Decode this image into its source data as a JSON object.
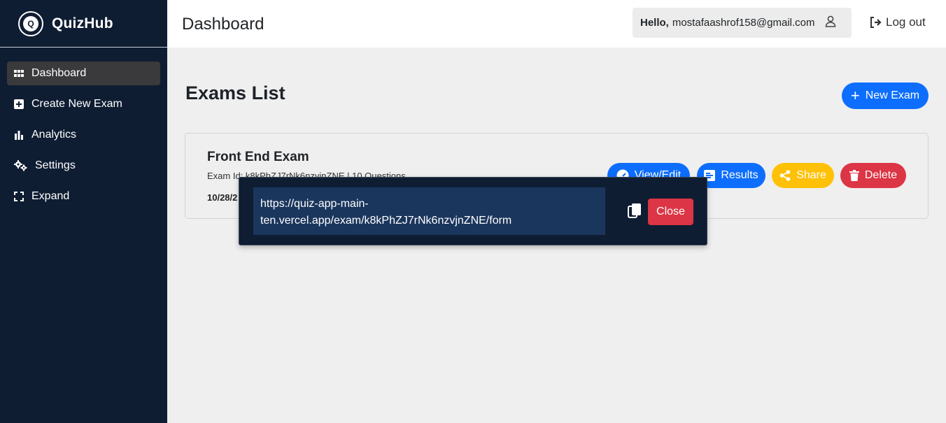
{
  "app": {
    "name": "QuizHub",
    "logo_letter": "Q"
  },
  "sidebar": {
    "items": [
      {
        "label": "Dashboard",
        "icon": "grid-icon",
        "active": true
      },
      {
        "label": "Create New Exam",
        "icon": "plus-square-icon"
      },
      {
        "label": "Analytics",
        "icon": "bar-chart-icon"
      },
      {
        "label": "Settings",
        "icon": "gears-icon"
      },
      {
        "label": "Expand",
        "icon": "expand-icon"
      }
    ]
  },
  "header": {
    "title": "Dashboard",
    "hello_label": "Hello,",
    "user_email": "mostafaashrof158@gmail.com",
    "logout_label": "Log out"
  },
  "main": {
    "title": "Exams List",
    "new_exam_label": "New Exam",
    "exam": {
      "name": "Front End Exam",
      "meta": "Exam Id: k8kPhZJ7rNk6nzvjnZNE  |  10 Questions",
      "date": "10/28/2"
    },
    "actions": {
      "view_label": "View/Edit",
      "results_label": "Results",
      "share_label": "Share",
      "delete_label": "Delete"
    }
  },
  "share_popup": {
    "link": "https://quiz-app-main-ten.vercel.app/exam/k8kPhZJ7rNk6nzvjnZNE/form",
    "close_label": "Close"
  },
  "colors": {
    "sidebar_bg": "#0f1d33",
    "primary": "#0d6efd",
    "warning": "#ffc107",
    "danger": "#dc3545",
    "link_box_bg": "#1b365d"
  }
}
